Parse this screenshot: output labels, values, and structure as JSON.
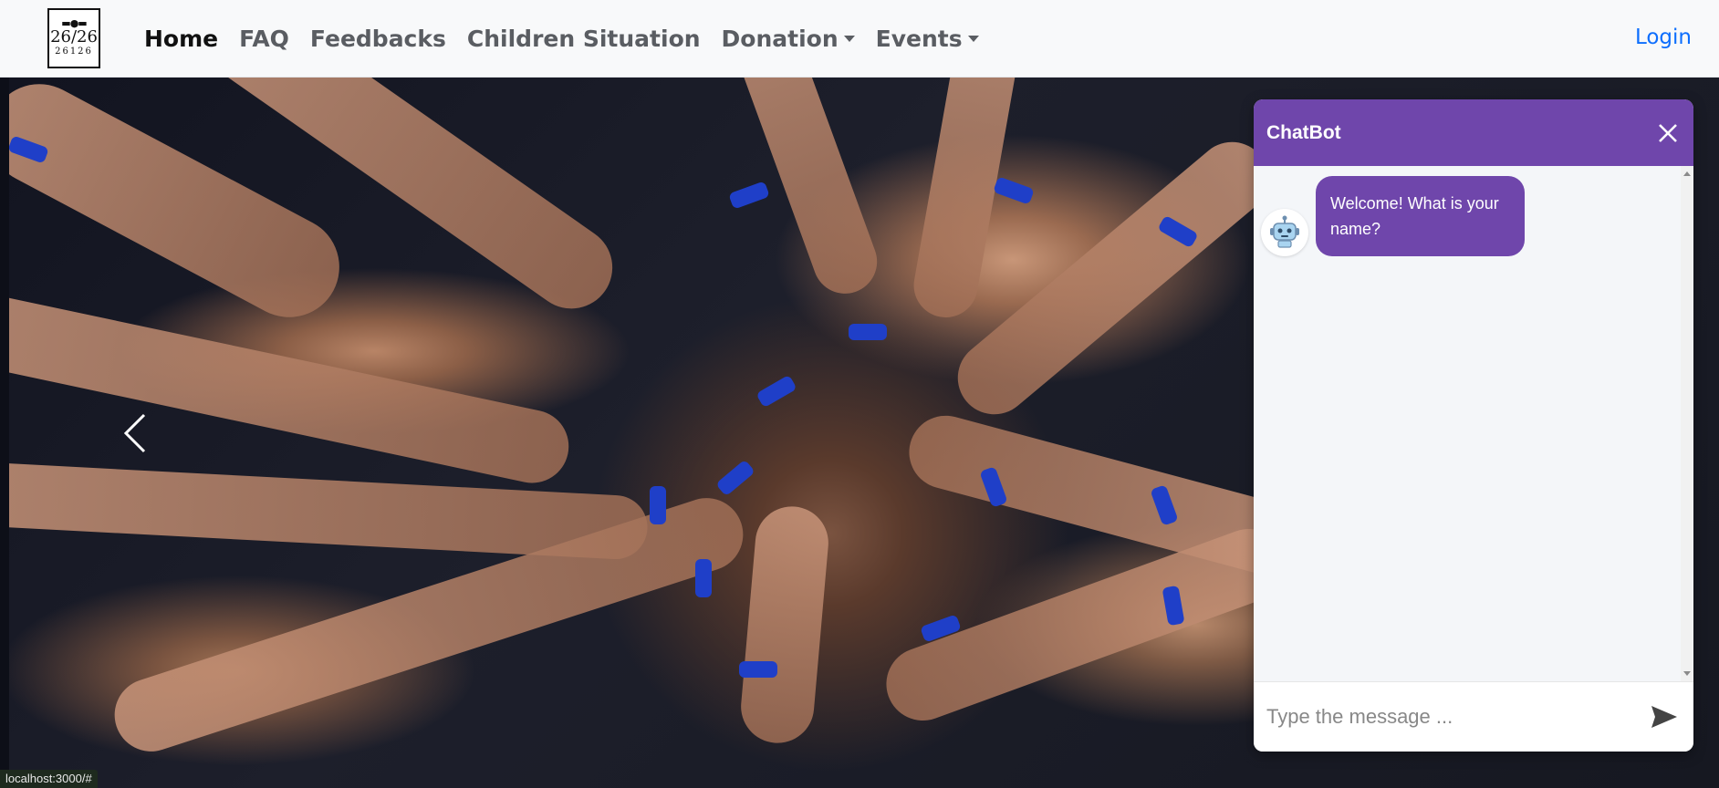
{
  "navbar": {
    "logo": {
      "mark": "▬●▬",
      "big": "26/26",
      "small": "26126"
    },
    "links": [
      {
        "label": "Home",
        "active": true
      },
      {
        "label": "FAQ"
      },
      {
        "label": "Feedbacks"
      },
      {
        "label": "Children Situation"
      },
      {
        "label": "Donation",
        "dropdown": true
      },
      {
        "label": "Events",
        "dropdown": true
      }
    ],
    "login_label": "Login"
  },
  "carousel": {
    "prev_icon": "chevron-left-icon"
  },
  "chatbot": {
    "title": "ChatBot",
    "close_icon": "close-icon",
    "messages": [
      {
        "from": "bot",
        "text": "Welcome! What is your name?"
      }
    ],
    "input_placeholder": "Type the message ...",
    "send_icon": "send-icon",
    "accent": "#6f46ab"
  },
  "status_url": "localhost:3000/#"
}
